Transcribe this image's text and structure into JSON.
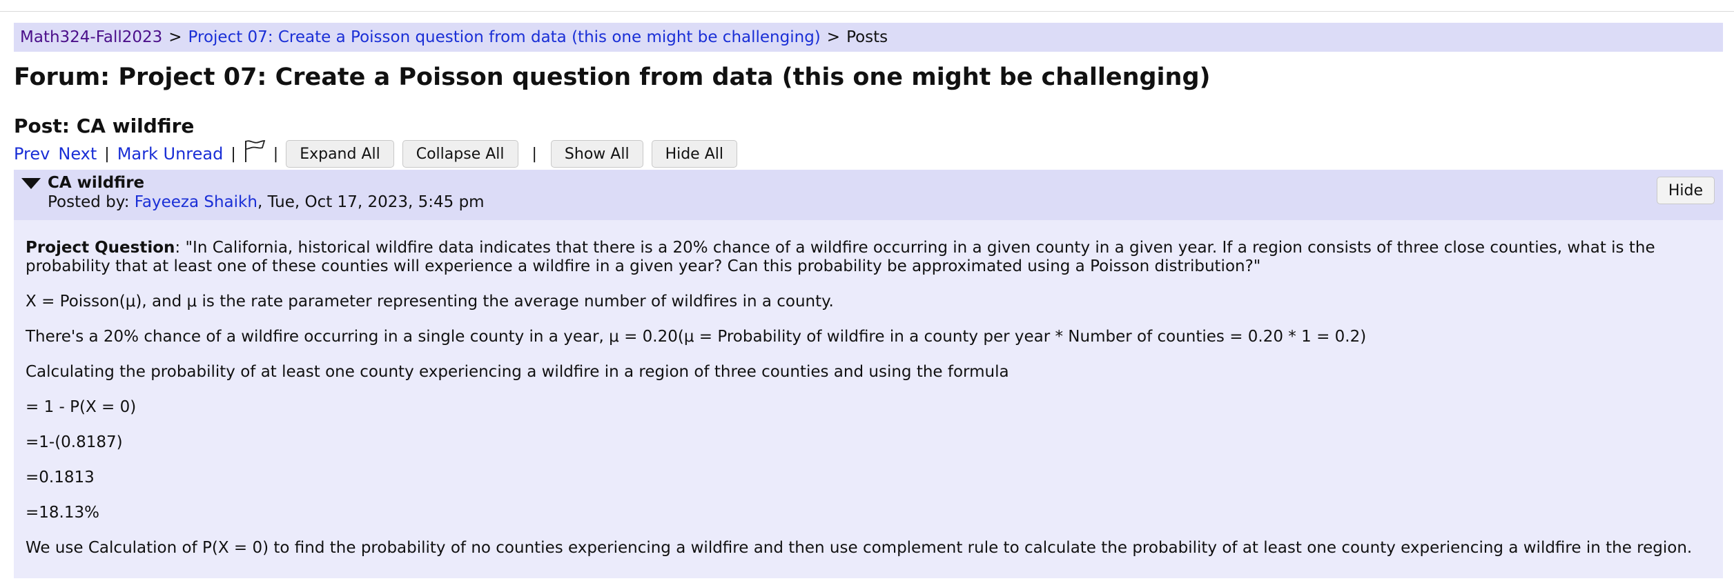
{
  "breadcrumb": {
    "course": "Math324-Fall2023",
    "separator": ">",
    "forum": "Project 07: Create a Poisson question from data (this one might be challenging)",
    "current": "Posts"
  },
  "forum_title": "Forum: Project 07: Create a Poisson question from data (this one might be challenging)",
  "post_title": "Post: CA wildfire",
  "toolbar": {
    "prev": "Prev",
    "next": "Next",
    "pipe": "|",
    "mark_unread": "Mark Unread",
    "expand_all": "Expand All",
    "collapse_all": "Collapse All",
    "show_all": "Show All",
    "hide_all": "Hide All",
    "flag_icon": "flag-icon"
  },
  "post": {
    "subject": "CA wildfire",
    "posted_by_label": "Posted by: ",
    "author": "Fayeeza Shaikh",
    "date": ", Tue, Oct 17, 2023, 5:45 pm",
    "hide_label": "Hide",
    "toggle_icon": "triangle-down-icon",
    "question_label": "Project Question",
    "question_text": ": \"In California, historical wildfire data indicates that there is a 20% chance of a wildfire occurring in a given county in a given year. If a region consists of three close counties, what is the probability that at least one of these counties will experience a wildfire in a given year? Can this probability be approximated using a Poisson distribution?\"",
    "paragraphs": [
      "X = Poisson(μ), and μ is the rate parameter representing the average number of wildfires in a county.",
      "There's a 20% chance of a wildfire occurring in a single county in a year, μ = 0.20(μ = Probability of wildfire in a county per year * Number of counties = 0.20 * 1 = 0.2)",
      "Calculating the probability of at least one county experiencing a wildfire in a region of three counties and using the formula",
      "= 1 - P(X = 0)",
      "=1-(0.8187)",
      "=0.1813",
      "=18.13%",
      "We use Calculation of P(X = 0) to find the probability of no counties experiencing a wildfire and then use complement rule to calculate the probability of at least one county experiencing a wildfire in the region."
    ]
  },
  "colors": {
    "link": "#1a2fd6",
    "visited_link": "#4b0f8a",
    "header_bg": "#dcdcf7",
    "body_bg": "#ebebfb"
  }
}
